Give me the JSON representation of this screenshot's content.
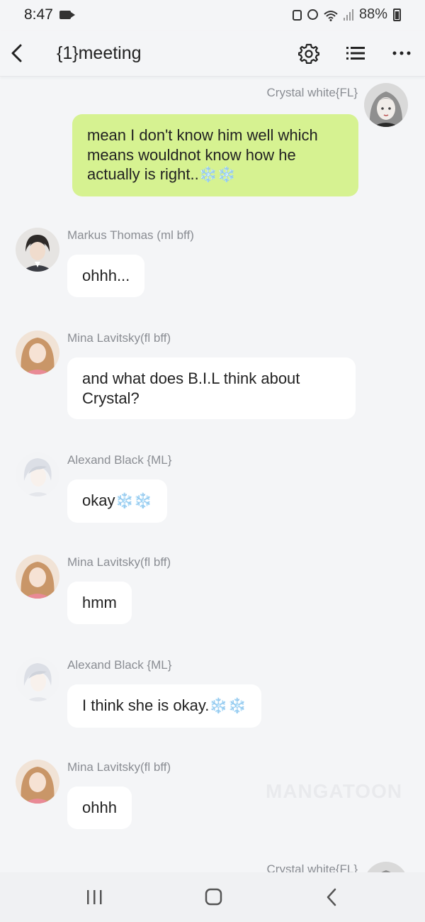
{
  "status_bar": {
    "time": "8:47",
    "battery": "88%",
    "icons": [
      "video-camera-icon",
      "lock-icon",
      "alarm-icon",
      "wifi-icon",
      "signal-icon",
      "battery-icon"
    ]
  },
  "header": {
    "title": "{1}meeting",
    "icons": [
      "back-arrow-icon",
      "gear-icon",
      "list-icon",
      "more-icon"
    ]
  },
  "messages": [
    {
      "sender": "Crystal white{FL}",
      "text": "mean I don't know him well which means wouldnot know how he actually is right..",
      "emoji": "❄️❄️",
      "outgoing": true
    },
    {
      "sender": "Markus Thomas  (ml bff)",
      "text": "ohhh...",
      "emoji": "",
      "outgoing": false
    },
    {
      "sender": "Mina Lavitsky(fl bff)",
      "text": "and what does B.I.L think about Crystal?",
      "emoji": "",
      "outgoing": false
    },
    {
      "sender": "Alexand Black {ML}",
      "text": "okay",
      "emoji": "❄️❄️",
      "outgoing": false
    },
    {
      "sender": "Mina Lavitsky(fl bff)",
      "text": "hmm",
      "emoji": "",
      "outgoing": false
    },
    {
      "sender": "Alexand Black {ML}",
      "text": "I think she is okay.",
      "emoji": "❄️❄️",
      "outgoing": false
    },
    {
      "sender": "Mina Lavitsky(fl bff)",
      "text": "ohhh",
      "emoji": "",
      "outgoing": false
    },
    {
      "sender": "Crystal white{FL}",
      "text": "",
      "emoji": "",
      "outgoing": true
    }
  ],
  "watermark": "MANGATOON",
  "nav_bar": {
    "icons": [
      "recent-apps-icon",
      "home-icon",
      "nav-back-icon"
    ]
  },
  "colors": {
    "background": "#f4f5f7",
    "outgoing_bubble": "#d6f291",
    "incoming_bubble": "#ffffff",
    "sender_text": "#8a8d93"
  }
}
